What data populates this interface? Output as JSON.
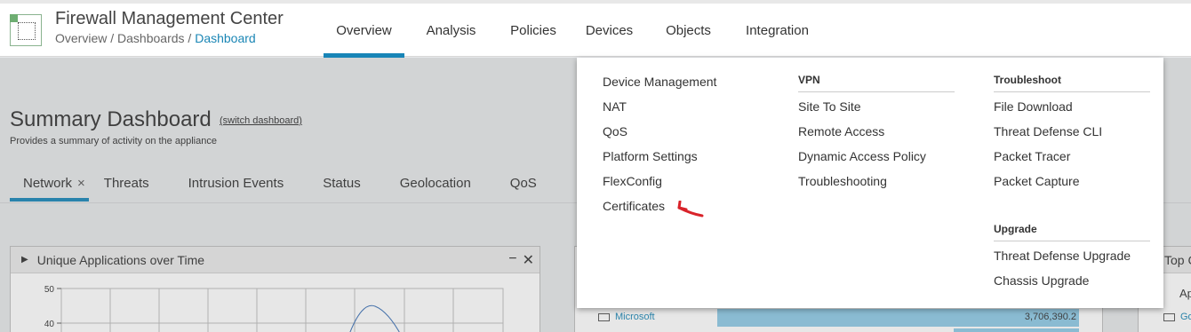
{
  "header": {
    "app_title": "Firewall Management Center",
    "breadcrumb": {
      "part1": "Overview",
      "sep1": " / ",
      "part2": "Dashboards",
      "sep2": " / ",
      "current": "Dashboard"
    },
    "nav": [
      "Overview",
      "Analysis",
      "Policies",
      "Devices",
      "Objects",
      "Integration"
    ],
    "active_nav": "Overview",
    "open_nav": "Devices"
  },
  "dashboard": {
    "title": "Summary Dashboard",
    "switch_link": "(switch dashboard)",
    "subtitle": "Provides a summary of activity on the appliance",
    "tabs": [
      "Network",
      "Threats",
      "Intrusion Events",
      "Status",
      "Geolocation",
      "QoS"
    ],
    "tab_close": "×"
  },
  "widget_left": {
    "title": "Unique Applications over Time",
    "minimize": "−",
    "close": "✕",
    "y_ticks": [
      "50",
      "40"
    ]
  },
  "widget_middle": {
    "row_label": "Microsoft",
    "row_value": "3,706,390.2"
  },
  "widget_right": {
    "title_partial": "Top C",
    "sub_partial": "Ap",
    "row_partial": "Go"
  },
  "devices_menu": {
    "col1": [
      "Device Management",
      "NAT",
      "QoS",
      "Platform Settings",
      "FlexConfig",
      "Certificates"
    ],
    "col2_heading": "VPN",
    "col2": [
      "Site To Site",
      "Remote Access",
      "Dynamic Access Policy",
      "Troubleshooting"
    ],
    "col3_heading": "Troubleshoot",
    "col3": [
      "File Download",
      "Threat Defense CLI",
      "Packet Tracer",
      "Packet Capture"
    ],
    "col3b_heading": "Upgrade",
    "col3b": [
      "Threat Defense Upgrade",
      "Chassis Upgrade"
    ]
  },
  "colors": {
    "accent": "#1885b7",
    "link": "#1a86b5",
    "bar": "#8ecae6",
    "annotation_arrow": "#d9232a"
  },
  "icons": {
    "annotation": "red-arrow-icon",
    "logo": "fmc-logo-icon",
    "folder": "folder-icon"
  }
}
